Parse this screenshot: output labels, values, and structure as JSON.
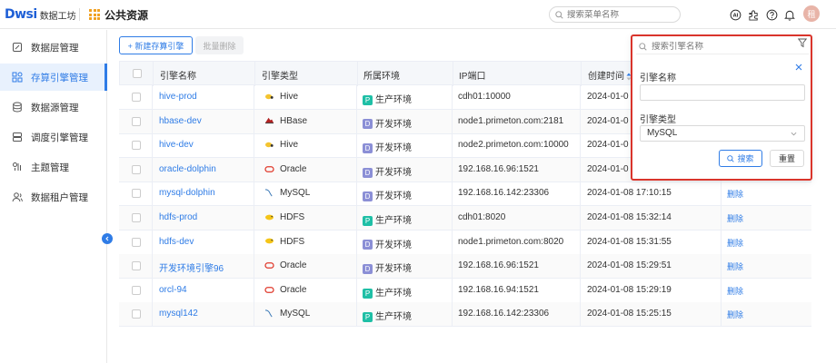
{
  "header": {
    "logo_mark": "Dwsi",
    "logo_text": "数据工坊",
    "title": "公共资源",
    "search_placeholder": "搜索菜单名称",
    "avatar_text": "租"
  },
  "sidebar": {
    "items": [
      {
        "label": "数据层管理",
        "icon": "layers-icon"
      },
      {
        "label": "存算引擎管理",
        "icon": "engine-icon",
        "active": true
      },
      {
        "label": "数据源管理",
        "icon": "database-icon"
      },
      {
        "label": "调度引擎管理",
        "icon": "scheduler-icon"
      },
      {
        "label": "主题管理",
        "icon": "theme-icon"
      },
      {
        "label": "数据租户管理",
        "icon": "tenant-icon"
      }
    ]
  },
  "toolbar": {
    "new_label": "+ 新建存算引擎",
    "batch_delete_label": "批量删除"
  },
  "table": {
    "columns": [
      "引擎名称",
      "引擎类型",
      "所属环境",
      "IP端口",
      "创建时间"
    ],
    "delete_label": "删除",
    "rows": [
      {
        "name": "hive-prod",
        "type": "Hive",
        "env_code": "P",
        "env": "生产环境",
        "ip": "cdh01:10000",
        "time": "2024-01-0"
      },
      {
        "name": "hbase-dev",
        "type": "HBase",
        "env_code": "D",
        "env": "开发环境",
        "ip": "node1.primeton.com:2181",
        "time": "2024-01-0"
      },
      {
        "name": "hive-dev",
        "type": "Hive",
        "env_code": "D",
        "env": "开发环境",
        "ip": "node2.primeton.com:10000",
        "time": "2024-01-0"
      },
      {
        "name": "oracle-dolphin",
        "type": "Oracle",
        "env_code": "D",
        "env": "开发环境",
        "ip": "192.168.16.96:1521",
        "time": "2024-01-0"
      },
      {
        "name": "mysql-dolphin",
        "type": "MySQL",
        "env_code": "D",
        "env": "开发环境",
        "ip": "192.168.16.142:23306",
        "time": "2024-01-08 17:10:15",
        "op": "删除"
      },
      {
        "name": "hdfs-prod",
        "type": "HDFS",
        "env_code": "P",
        "env": "生产环境",
        "ip": "cdh01:8020",
        "time": "2024-01-08 15:32:14",
        "op": "删除"
      },
      {
        "name": "hdfs-dev",
        "type": "HDFS",
        "env_code": "D",
        "env": "开发环境",
        "ip": "node1.primeton.com:8020",
        "time": "2024-01-08 15:31:55",
        "op": "删除"
      },
      {
        "name": "开发环境引擎96",
        "type": "Oracle",
        "env_code": "D",
        "env": "开发环境",
        "ip": "192.168.16.96:1521",
        "time": "2024-01-08 15:29:51",
        "op": "删除"
      },
      {
        "name": "orcl-94",
        "type": "Oracle",
        "env_code": "P",
        "env": "生产环境",
        "ip": "192.168.16.94:1521",
        "time": "2024-01-08 15:29:19",
        "op": "删除"
      },
      {
        "name": "mysql142",
        "type": "MySQL",
        "env_code": "P",
        "env": "生产环境",
        "ip": "192.168.16.142:23306",
        "time": "2024-01-08 15:25:15",
        "op": "删除"
      }
    ]
  },
  "filter": {
    "search_placeholder": "搜索引擎名称",
    "name_label": "引擎名称",
    "name_value": "",
    "type_label": "引擎类型",
    "type_value": "MySQL",
    "search_btn": "搜索",
    "reset_btn": "重置"
  },
  "colors": {
    "accent": "#2f7ce6",
    "highlight_border": "#d9342b",
    "env_prod": "#1fbfa6",
    "env_dev": "#8b8fd6"
  }
}
